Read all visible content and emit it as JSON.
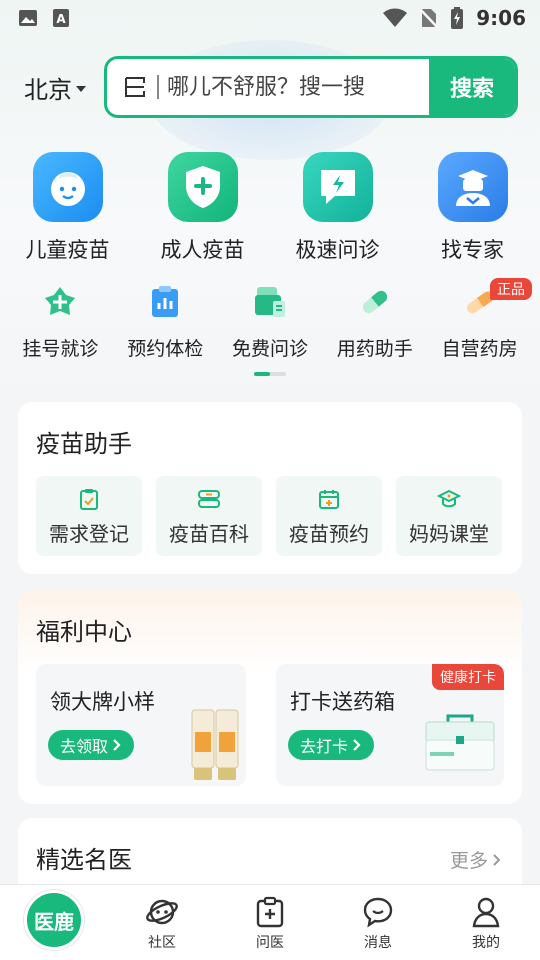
{
  "status_bar": {
    "time": "9:06"
  },
  "header": {
    "city": "北京",
    "search_placeholder": "哪儿不舒服？搜一搜",
    "search_button": "搜索"
  },
  "big_grid": [
    {
      "label": "儿童疫苗",
      "icon": "baby-face-icon",
      "color": "#1d9df0"
    },
    {
      "label": "成人疫苗",
      "icon": "shield-plus-icon",
      "color": "#1bc28a"
    },
    {
      "label": "极速问诊",
      "icon": "chat-lightning-icon",
      "color": "#18bfa6"
    },
    {
      "label": "找专家",
      "icon": "doctor-icon",
      "color": "#2f8df0"
    }
  ],
  "small_grid": [
    {
      "label": "挂号就诊",
      "icon": "register-icon"
    },
    {
      "label": "预约体检",
      "icon": "checkup-icon"
    },
    {
      "label": "免费问诊",
      "icon": "free-consult-icon"
    },
    {
      "label": "用药助手",
      "icon": "pill-icon"
    },
    {
      "label": "自营药房",
      "icon": "pharmacy-icon",
      "badge": "正品"
    }
  ],
  "vaccine_card": {
    "title": "疫苗助手",
    "items": [
      {
        "label": "需求登记",
        "icon": "clipboard-check-icon"
      },
      {
        "label": "疫苗百科",
        "icon": "encyclopedia-icon"
      },
      {
        "label": "疫苗预约",
        "icon": "calendar-icon"
      },
      {
        "label": "妈妈课堂",
        "icon": "graduation-cap-icon"
      }
    ]
  },
  "welfare_card": {
    "title": "福利中心",
    "left": {
      "title": "领大牌小样",
      "button": "去领取"
    },
    "right": {
      "title": "打卡送药箱",
      "button": "去打卡",
      "tag": "健康打卡"
    }
  },
  "doctor_card": {
    "title": "精选名医",
    "more": "更多"
  },
  "tabbar": {
    "home": "医鹿",
    "tabs": [
      {
        "label": "社区",
        "icon": "planet-icon"
      },
      {
        "label": "问医",
        "icon": "medical-record-icon"
      },
      {
        "label": "消息",
        "icon": "message-icon"
      },
      {
        "label": "我的",
        "icon": "user-icon"
      }
    ]
  },
  "colors": {
    "brand": "#19b87c",
    "badge": "#e8473a"
  }
}
